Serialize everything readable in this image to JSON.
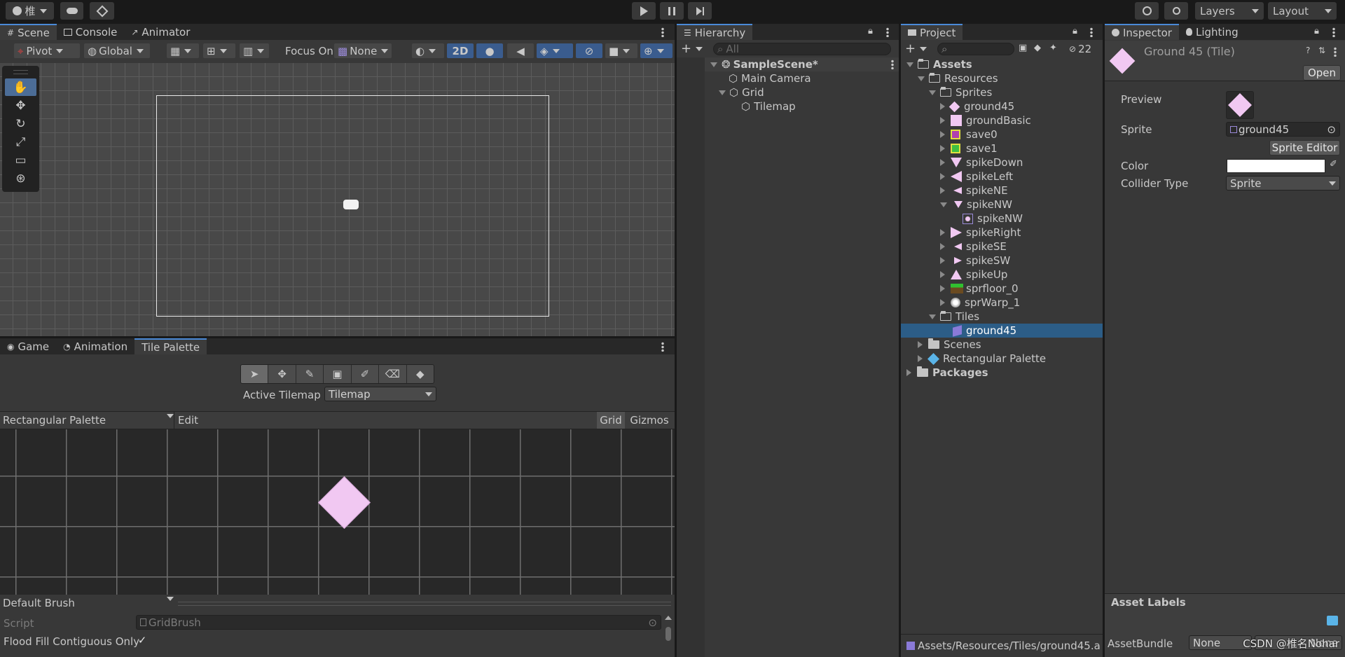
{
  "topbar": {
    "account_icon": "account-icon",
    "account_label": "椎",
    "cloud_icon": "cloud-icon",
    "collab_icon": "collab-icon",
    "play_icon": "play-icon",
    "pause_icon": "pause-icon",
    "step_icon": "step-icon",
    "history_icon": "history-icon",
    "search_icon": "search-icon",
    "layers_label": "Layers",
    "layout_label": "Layout"
  },
  "scene_panel": {
    "tabs": [
      {
        "label": "Scene",
        "icon": "grid-icon"
      },
      {
        "label": "Console",
        "icon": "console-icon"
      },
      {
        "label": "Animator",
        "icon": "animator-icon"
      }
    ],
    "pivot_label": "Pivot",
    "global_label": "Global",
    "focus_on_label": "Focus On",
    "focus_value": "None",
    "mode_2d_label": "2D"
  },
  "palette_panel": {
    "tabs": [
      {
        "label": "Game",
        "icon": "gamepad-icon"
      },
      {
        "label": "Animation",
        "icon": "clock-icon"
      },
      {
        "label": "Tile Palette",
        "icon": ""
      }
    ],
    "active_tilemap_label": "Active Tilemap",
    "active_tilemap_value": "Tilemap",
    "palette_name": "Rectangular Palette",
    "edit_label": "Edit",
    "grid_label": "Grid",
    "gizmos_label": "Gizmos",
    "brush_label": "Default Brush",
    "script_label": "Script",
    "script_value": "GridBrush",
    "flood_fill_label": "Flood Fill Contiguous Only"
  },
  "hierarchy": {
    "tab_label": "Hierarchy",
    "search_placeholder": "All",
    "items": [
      {
        "label": "SampleScene*"
      },
      {
        "label": "Main Camera"
      },
      {
        "label": "Grid"
      },
      {
        "label": "Tilemap"
      }
    ]
  },
  "project": {
    "tab_label": "Project",
    "hidden_count": "22",
    "tree": [
      {
        "label": "Assets"
      },
      {
        "label": "Resources"
      },
      {
        "label": "Sprites"
      },
      {
        "label": "ground45"
      },
      {
        "label": "groundBasic"
      },
      {
        "label": "save0"
      },
      {
        "label": "save1"
      },
      {
        "label": "spikeDown"
      },
      {
        "label": "spikeLeft"
      },
      {
        "label": "spikeNE"
      },
      {
        "label": "spikeNW"
      },
      {
        "label": "spikeNW"
      },
      {
        "label": "spikeRight"
      },
      {
        "label": "spikeSE"
      },
      {
        "label": "spikeSW"
      },
      {
        "label": "spikeUp"
      },
      {
        "label": "sprfloor_0"
      },
      {
        "label": "sprWarp_1"
      },
      {
        "label": "Tiles"
      },
      {
        "label": "ground45"
      },
      {
        "label": "Scenes"
      },
      {
        "label": "Rectangular Palette"
      },
      {
        "label": "Packages"
      }
    ],
    "footer_path": "Assets/Resources/Tiles/ground45.a"
  },
  "inspector": {
    "tabs": [
      {
        "label": "Inspector",
        "icon": "info-icon"
      },
      {
        "label": "Lighting",
        "icon": "bulb-icon"
      }
    ],
    "title": "Ground 45 (Tile)",
    "open_label": "Open",
    "preview_label": "Preview",
    "sprite_label": "Sprite",
    "sprite_value": "ground45",
    "sprite_editor_label": "Sprite Editor",
    "color_label": "Color",
    "color_value": "#ffffff",
    "collider_label": "Collider Type",
    "collider_value": "Sprite",
    "asset_labels_label": "Asset Labels",
    "assetbundle_label": "AssetBundle",
    "assetbundle_value": "None",
    "assetbundle_variant": "None"
  },
  "watermark": "CSDN @椎名Nohar",
  "colors": {
    "selection": "#2c5d87",
    "tile_pink": "#f1c8f2",
    "tab_accent": "#4a8ad8"
  }
}
